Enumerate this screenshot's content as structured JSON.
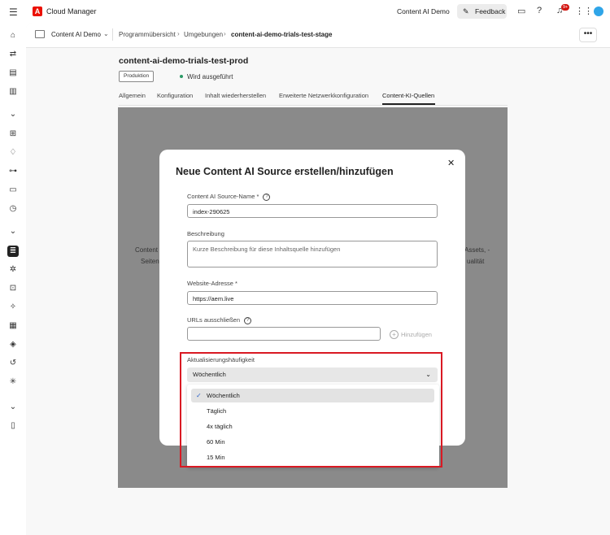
{
  "topbar": {
    "app_title": "Cloud Manager",
    "org_name": "Content AI Demo",
    "feedback_label": "Feedback",
    "notification_count": "9+"
  },
  "breadcrumb": {
    "program": "Content AI Demo",
    "items": [
      "Programmübersicht",
      "Umgebungen",
      "content-ai-demo-trials-test-stage"
    ]
  },
  "environment": {
    "title": "content-ai-demo-trials-test-prod",
    "badge": "Produktion",
    "status": "Wird ausgeführt"
  },
  "tabs": [
    "Allgemein",
    "Konfiguration",
    "Inhalt wiederherstellen",
    "Erweiterte Netzwerkkonfiguration",
    "Content-KI-Quellen"
  ],
  "background_text": {
    "left1": "Content",
    "left2": "Seiten",
    "right1": "Assets, -",
    "right2": "ualität"
  },
  "dialog": {
    "title": "Neue Content AI Source erstellen/hinzufügen",
    "name_label": "Content AI Source-Name",
    "name_value": "index-290625",
    "description_label": "Beschreibung",
    "description_placeholder": "Kurze Beschreibung für diese Inhaltsquelle hinzufügen",
    "website_label": "Website-Adresse",
    "website_value": "https://aem.live",
    "exclude_label": "URLs ausschließen",
    "add_label": "Hinzufügen",
    "frequency_label": "Aktualisierungshäufigkeit",
    "frequency_value": "Wöchentlich",
    "frequency_options": [
      "Wöchentlich",
      "Täglich",
      "4x täglich",
      "60 Min",
      "15 Min"
    ]
  },
  "colors": {
    "highlight": "#d91923",
    "adobe_red": "#eb1000",
    "accent_blue": "#2e63c9",
    "status_green": "#2b9a66"
  }
}
